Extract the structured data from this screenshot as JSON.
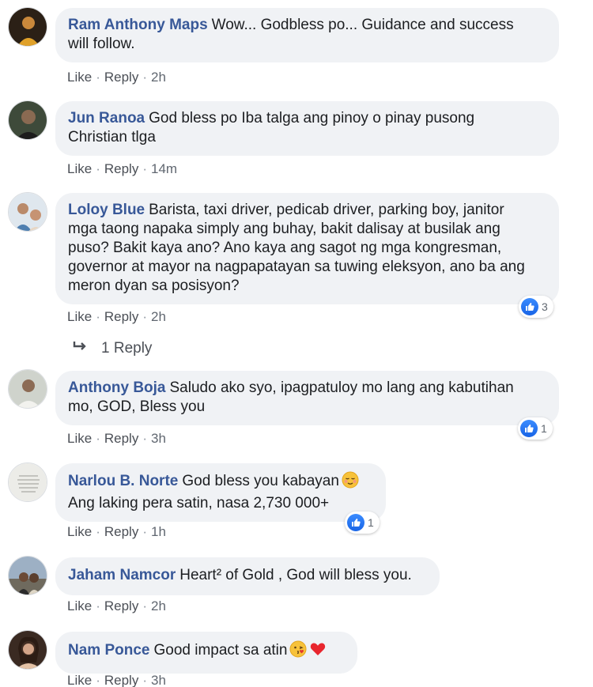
{
  "comments": [
    {
      "author": "Ram Anthony Maps",
      "text": "Wow... Godbless po... Guidance and success",
      "text2": "will follow.",
      "like": "Like",
      "reply": "Reply",
      "time": "2h"
    },
    {
      "author": "Jun Ranoa",
      "text": "God bless po Iba talga ang pinoy o pinay pusong",
      "text2": "Christian tlga",
      "like": "Like",
      "reply": "Reply",
      "time": "14m"
    },
    {
      "author": "Loloy Blue",
      "text": "Barista, taxi driver, pedicab driver, parking boy, janitor",
      "text2": "mga taong napaka simply ang buhay, bakit dalisay at busilak ang",
      "text3": "puso? Bakit kaya ano? Ano kaya ang sagot ng mga kongresman,",
      "text4": "governor at mayor na nagpapatayan sa tuwing eleksyon, ano ba ang",
      "text5": "meron dyan sa posisyon?",
      "like": "Like",
      "reply": "Reply",
      "time": "2h",
      "reactions": "3"
    },
    {
      "author": "Anthony Boja",
      "text": "Saludo ako syo, ipagpatuloy mo lang ang kabutihan",
      "text2": "mo, GOD, Bless you",
      "like": "Like",
      "reply": "Reply",
      "time": "3h",
      "reactions": "1"
    },
    {
      "author": "Narlou B. Norte",
      "text": "God bless you kabayan",
      "text2": "Ang laking pera satin, nasa 2,730 000+",
      "like": "Like",
      "reply": "Reply",
      "time": "1h",
      "reactions": "1"
    },
    {
      "author": "Jaham Namcor",
      "text": "Heart² of Gold , God will bless you.",
      "like": "Like",
      "reply": "Reply",
      "time": "2h"
    },
    {
      "author": "Nam Ponce",
      "text": "Good impact sa atin",
      "like": "Like",
      "reply": "Reply",
      "time": "3h"
    }
  ],
  "replies_link": "1 Reply",
  "icons": {
    "like": "like-thumb-icon",
    "reply_arrow": "reply-arrow-icon",
    "relieved": "relieved-face-emoji",
    "kiss": "kissing-face-emoji",
    "heart": "red-heart-emoji"
  },
  "colors": {
    "author": "#385898",
    "bubble": "#f0f2f5",
    "like_blue": "#1864e6"
  }
}
